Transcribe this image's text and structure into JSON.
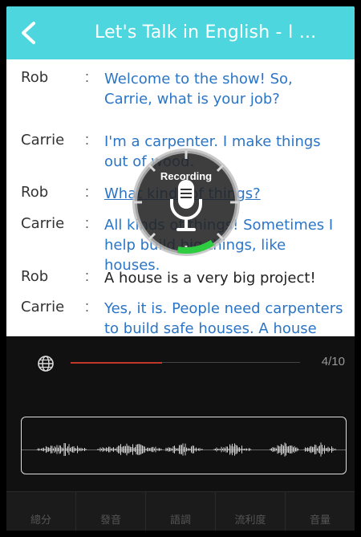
{
  "header": {
    "title": "Let's Talk in English - I ..."
  },
  "dialog": [
    {
      "speaker": "Rob",
      "text": "Welcome to the show! So, Carrie, what is your job?"
    },
    {
      "speaker": "Carrie",
      "text": "I'm a carpenter. I make things out of wood."
    },
    {
      "speaker": "Rob",
      "text": "What kinds of things?"
    },
    {
      "speaker": "Carrie",
      "text": "All kinds of things! Sometimes I help build big things, like houses."
    },
    {
      "speaker": "Rob",
      "text": "A house is a very big project!"
    },
    {
      "speaker": "Carrie",
      "text": "Yes, it is. People need carpenters to build safe houses. A house shouldn't"
    }
  ],
  "recording": {
    "label": "Recording",
    "progress": 0.12
  },
  "player": {
    "progress": 0.4,
    "page_count": "4/10"
  },
  "tabs": [
    "總分",
    "發音",
    "語調",
    "流利度",
    "音量"
  ],
  "colors": {
    "header": "#4dd6de",
    "dialog_text": "#2b75c7",
    "progress": "#c0392b",
    "recording_level": "#2ecc40"
  },
  "icons": {
    "back": "chevron-left-icon",
    "microphone": "microphone-icon",
    "language": "globe-icon"
  }
}
